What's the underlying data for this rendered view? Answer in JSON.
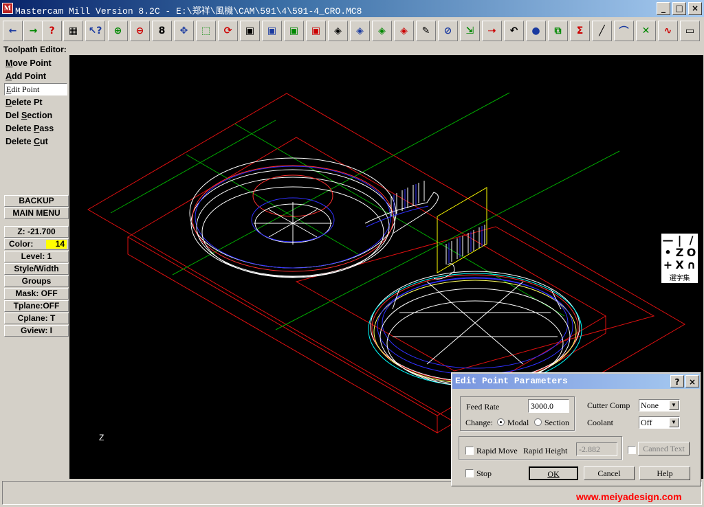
{
  "window": {
    "title": "Mastercam Mill Version 8.2C - E:\\郑祥\\風機\\CAM\\591\\4\\591-4_CRO.MC8",
    "app_icon": "mastercam-icon",
    "minimize_label": "_",
    "maximize_label": "□",
    "close_label": "×"
  },
  "toolbar": {
    "buttons": [
      {
        "name": "back-arrow-icon",
        "glyph": "←"
      },
      {
        "name": "forward-arrow-icon",
        "glyph": "→"
      },
      {
        "name": "help-question-icon",
        "glyph": "?"
      },
      {
        "name": "calculator-icon",
        "glyph": "▦"
      },
      {
        "name": "analyze-icon",
        "glyph": "↖?"
      },
      {
        "name": "zoom-window-icon",
        "glyph": "⊕"
      },
      {
        "name": "unzoom-icon",
        "glyph": "⊖"
      },
      {
        "name": "zoom-8-icon",
        "glyph": "8"
      },
      {
        "name": "pan-icon",
        "glyph": "✥"
      },
      {
        "name": "select-window-icon",
        "glyph": "⬚"
      },
      {
        "name": "rotate-view-icon",
        "glyph": "⟳"
      },
      {
        "name": "cube-top-icon",
        "glyph": "▣"
      },
      {
        "name": "cube-front-icon",
        "glyph": "▣"
      },
      {
        "name": "cube-side-icon",
        "glyph": "▣"
      },
      {
        "name": "cube-iso-icon",
        "glyph": "▣"
      },
      {
        "name": "cplane-top-icon",
        "glyph": "◈"
      },
      {
        "name": "cplane-front-icon",
        "glyph": "◈"
      },
      {
        "name": "cplane-side-icon",
        "glyph": "◈"
      },
      {
        "name": "cplane-3d-icon",
        "glyph": "◈"
      },
      {
        "name": "pencil-icon",
        "glyph": "✎"
      },
      {
        "name": "delete-icon",
        "glyph": "⊘"
      },
      {
        "name": "transform-icon",
        "glyph": "⇲"
      },
      {
        "name": "translate-icon",
        "glyph": "⇢"
      },
      {
        "name": "undo-icon",
        "glyph": "↶"
      },
      {
        "name": "shade-sphere-icon",
        "glyph": "●"
      },
      {
        "name": "backplot-icon",
        "glyph": "⧉"
      },
      {
        "name": "sum-icon",
        "glyph": "Σ"
      },
      {
        "name": "line-icon",
        "glyph": "╱"
      },
      {
        "name": "arc-icon",
        "glyph": "⌒"
      },
      {
        "name": "trim-icon",
        "glyph": "✕"
      },
      {
        "name": "spline-icon",
        "glyph": "∿"
      },
      {
        "name": "rectangle-icon",
        "glyph": "▭"
      }
    ]
  },
  "prompt": "Toolpath Editor:",
  "menu": {
    "items": [
      {
        "label": "Move Point",
        "key": "M",
        "selected": false
      },
      {
        "label": "Add Point",
        "key": "A",
        "selected": false
      },
      {
        "label": "Edit Point",
        "key": "E",
        "selected": true
      },
      {
        "label": "Delete Pt",
        "key": "D",
        "selected": false
      },
      {
        "label": "Del Section",
        "key": "S",
        "selected": false
      },
      {
        "label": "Delete Pass",
        "key": "P",
        "selected": false
      },
      {
        "label": "Delete Cut",
        "key": "C",
        "selected": false
      }
    ],
    "backup": "BACKUP",
    "main_menu": "MAIN MENU",
    "z": "Z: -21.700",
    "color_label": "Color:",
    "color_value": "14",
    "level": "Level:  1",
    "style_width": "Style/Width",
    "groups": "Groups",
    "mask": "Mask:  OFF",
    "tplane": "Tplane:OFF",
    "cplane": "Cplane:  T",
    "gview": "Gview:   I"
  },
  "viewport": {
    "axis_label": "Z"
  },
  "palette": {
    "cells": [
      "—",
      "|",
      "/",
      "•",
      "Z",
      "O",
      "+",
      "X",
      "∩"
    ],
    "caption": "選字集"
  },
  "dialog": {
    "title": "Edit Point Parameters",
    "help_label": "?",
    "close_label": "×",
    "feed_rate_label": "Feed Rate",
    "feed_rate_value": "3000.0",
    "change_label": "Change:",
    "modal_label": "Modal",
    "section_label": "Section",
    "cutter_comp_label": "Cutter Comp",
    "cutter_comp_value": "None",
    "coolant_label": "Coolant",
    "coolant_value": "Off",
    "rapid_move_label": "Rapid Move",
    "rapid_height_label": "Rapid Height",
    "rapid_height_value": "-2.882",
    "canned_text_label": "Canned Text",
    "stop_label": "Stop",
    "ok_label": "OK",
    "cancel_label": "Cancel",
    "help_button_label": "Help"
  },
  "watermark": "www.meiyadesign.com",
  "colors": {
    "title_gradient_start": "#0a246a",
    "viewport_bg": "#000000",
    "selection_color": "#ffff00",
    "toolpath_red": "#ff0000",
    "toolpath_blue": "#0000ff",
    "geometry_white": "#ffffff",
    "grid_green": "#00aa00"
  }
}
